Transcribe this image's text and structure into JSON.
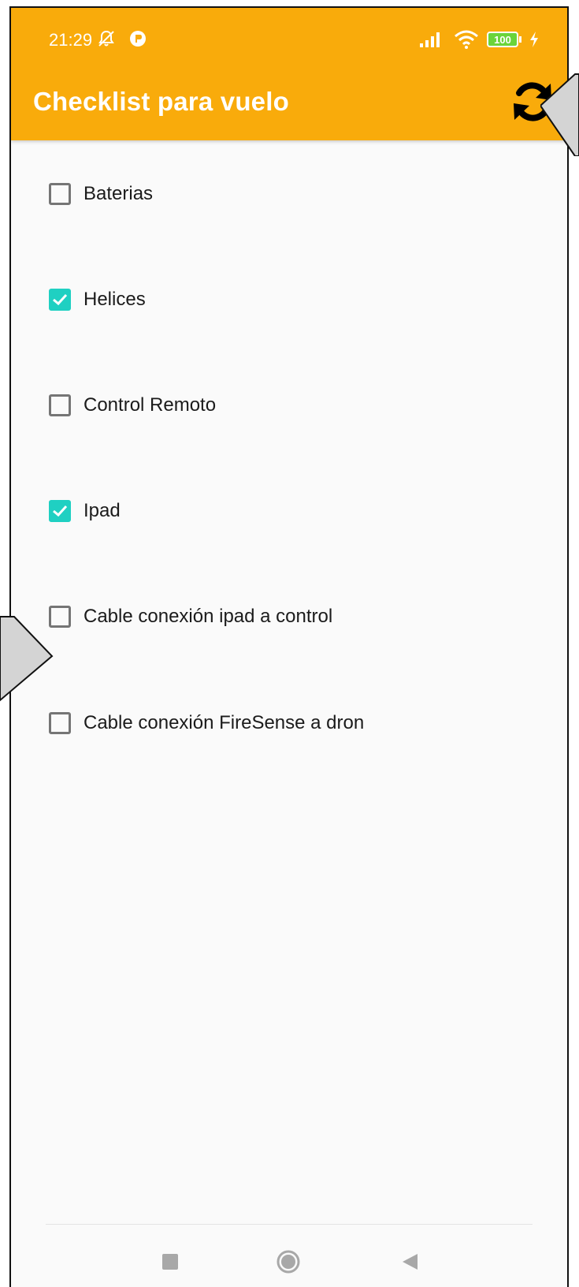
{
  "status_bar": {
    "time": "21:29",
    "battery": "100"
  },
  "app_bar": {
    "title": "Checklist para vuelo",
    "refresh_icon": "refresh-icon"
  },
  "checklist": {
    "items": [
      {
        "label": "Baterias",
        "checked": false
      },
      {
        "label": "Helices",
        "checked": true
      },
      {
        "label": "Control Remoto",
        "checked": false
      },
      {
        "label": "Ipad",
        "checked": true
      },
      {
        "label": "Cable conexión ipad a control",
        "checked": false
      },
      {
        "label": "Cable conexión FireSense a dron",
        "checked": false
      }
    ]
  },
  "nav_bar": {
    "recents_icon": "square-icon",
    "home_icon": "circle-icon",
    "back_icon": "back-triangle-icon"
  },
  "colors": {
    "app_bar": "#f9ab0b",
    "checkbox_checked": "#1fd0c2",
    "checkbox_unchecked": "#757575"
  }
}
